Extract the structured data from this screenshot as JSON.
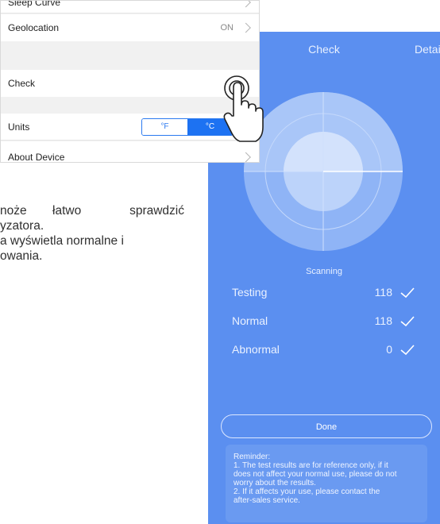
{
  "settings": {
    "rows": [
      {
        "label": "Sleep Curve"
      },
      {
        "label": "Geolocation",
        "status": "ON"
      },
      {
        "label": "Check"
      },
      {
        "label": "Units"
      },
      {
        "label": "About Device"
      }
    ],
    "units": {
      "fahrenheit": "°F",
      "celsius": "°C",
      "selected": "°C"
    }
  },
  "polish_text": {
    "line1a": "noże",
    "line1b": "łatwo",
    "line1c": "sprawdzić",
    "line2": "yzatora.",
    "line3": "a wyświetla normalne i",
    "line4": "owania."
  },
  "check_screen": {
    "title": "Check",
    "detail": "Detail",
    "scanning": "Scanning",
    "results": [
      {
        "label": "Testing",
        "value": "118"
      },
      {
        "label": "Normal",
        "value": "118"
      },
      {
        "label": "Abnormal",
        "value": "0"
      }
    ],
    "done_label": "Done",
    "reminder": {
      "line1": "Reminder:",
      "line2": "1. The test results are for reference only, if it",
      "line3": "does not affect your normal use, please do not",
      "line4": "worry about the results.",
      "line5": "2. If it affects your use, please contact the",
      "line6": "after-sales service."
    }
  },
  "colors": {
    "phone_bg": "#5b8ff0",
    "accent": "#1d72f2",
    "toggle_border": "#2b7af0"
  }
}
